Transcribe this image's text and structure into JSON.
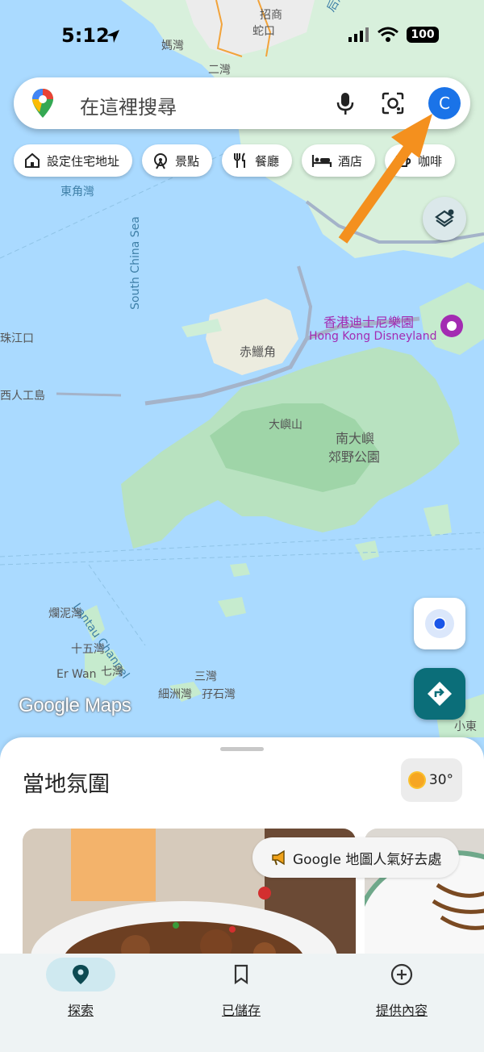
{
  "status_bar": {
    "time": "5:12",
    "battery": "100"
  },
  "search": {
    "placeholder": "在這裡搜尋",
    "avatar_letter": "C"
  },
  "chips": [
    {
      "label": "設定住宅地址",
      "icon": "home-icon"
    },
    {
      "label": "景點",
      "icon": "attraction-icon"
    },
    {
      "label": "餐廳",
      "icon": "restaurant-icon"
    },
    {
      "label": "酒店",
      "icon": "hotel-icon"
    },
    {
      "label": "咖啡",
      "icon": "coffee-icon"
    }
  ],
  "map": {
    "labels": {
      "zhaoshang": "招商",
      "shekou": "蛇口",
      "mawan": "媽灣",
      "erwan": "二灣",
      "houhaiwan": "后海灣 (深圳灣)",
      "dongjiaowan": "東角灣",
      "south_china_sea": "South China Sea",
      "zhujiangkou": "珠江口",
      "artificial_island": "西人工島",
      "chek_lap_kok": "赤鱲角",
      "disneyland_zh": "香港迪士尼樂園",
      "disneyland_en": "Hong Kong Disneyland",
      "lantau_peak": "大嶼山",
      "south_lantau_zh1": "南大嶼",
      "south_lantau_zh2": "郊野公園",
      "lantau_channel": "Lantau Channel",
      "lanniwan": "爛泥灣",
      "shiwuwan": "十五灣",
      "er_wan": "Er Wan",
      "qiwan": "七灣",
      "sanwan": "三灣",
      "xizhouwan": "細洲灣",
      "yashiwan": "孖石灣",
      "xiaodong": "小東"
    },
    "brand": "Google Maps"
  },
  "sheet": {
    "title": "當地氛圍",
    "weather": "30°",
    "popular_chip": "Google 地圖人氣好去處"
  },
  "nav": [
    {
      "label": "探索",
      "icon": "explore-pin-icon",
      "active": true
    },
    {
      "label": "已儲存",
      "icon": "bookmark-icon",
      "active": false
    },
    {
      "label": "提供內容",
      "icon": "add-circle-icon",
      "active": false
    }
  ],
  "colors": {
    "water": "#aadaff",
    "land": "#cfeed7",
    "accent": "#0b6e79",
    "avatar": "#1a73e8",
    "arrow": "#f4901e"
  }
}
